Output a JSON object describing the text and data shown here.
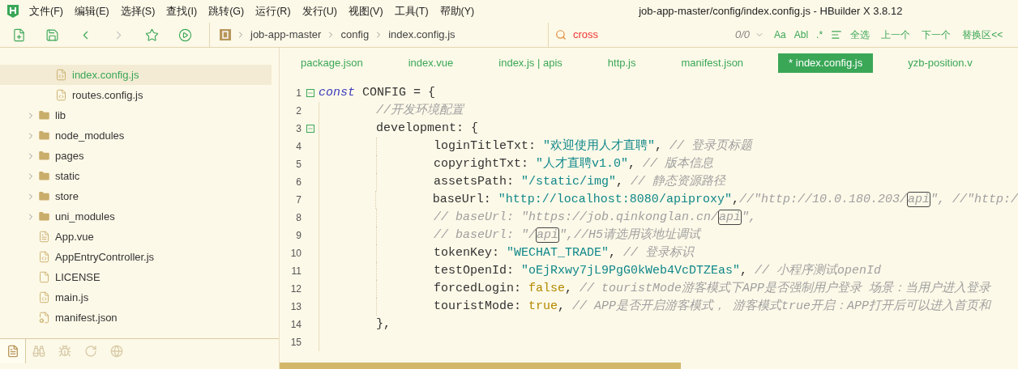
{
  "window": {
    "title": "job-app-master/config/index.config.js - HBuilder X 3.8.12"
  },
  "menu_bar": {
    "items": [
      "文件(F)",
      "编辑(E)",
      "选择(S)",
      "查找(I)",
      "跳转(G)",
      "运行(R)",
      "发行(U)",
      "视图(V)",
      "工具(T)",
      "帮助(Y)"
    ]
  },
  "toolbar": {
    "buttons": [
      {
        "kind": "new-file",
        "disabled": false
      },
      {
        "kind": "save",
        "disabled": false
      },
      {
        "kind": "back",
        "disabled": false
      },
      {
        "kind": "forward",
        "disabled": true
      },
      {
        "kind": "favorite",
        "disabled": false
      },
      {
        "kind": "run",
        "disabled": false
      }
    ]
  },
  "breadcrumb": [
    "job-app-master",
    "config",
    "index.config.js"
  ],
  "find_bar": {
    "value": "cross",
    "count": "0/0",
    "options": [
      "Aa",
      "Abl",
      ".*"
    ],
    "actions": [
      "全选",
      "上一个",
      "下一个",
      "替换区<<"
    ]
  },
  "sidebar": {
    "tree": [
      {
        "children": [
          {
            "label": "index.config.js",
            "kind": "js",
            "selected": true
          },
          {
            "label": "routes.config.js",
            "kind": "js",
            "selected": false
          }
        ]
      },
      {
        "label": "lib",
        "kind": "folder",
        "selected": false,
        "expanded": false
      },
      {
        "label": "node_modules",
        "kind": "folder",
        "selected": false,
        "expanded": false
      },
      {
        "label": "pages",
        "kind": "folder",
        "selected": false,
        "expanded": false
      },
      {
        "label": "static",
        "kind": "folder",
        "selected": false,
        "expanded": false
      },
      {
        "label": "store",
        "kind": "folder",
        "selected": false,
        "expanded": false
      },
      {
        "label": "uni_modules",
        "kind": "folder",
        "selected": false,
        "expanded": false
      },
      {
        "label": "App.vue",
        "kind": "vue",
        "selected": false
      },
      {
        "label": "AppEntryController.js",
        "kind": "js",
        "selected": false
      },
      {
        "label": "LICENSE",
        "kind": "text",
        "selected": false
      },
      {
        "label": "main.js",
        "kind": "js",
        "selected": false
      },
      {
        "label": "manifest.json",
        "kind": "config",
        "selected": false
      }
    ],
    "bottom_tabs": [
      {
        "kind": "files",
        "selected": true
      },
      {
        "kind": "search",
        "selected": false
      },
      {
        "kind": "debug",
        "selected": false
      },
      {
        "kind": "sync",
        "selected": false
      },
      {
        "kind": "cloud",
        "selected": false
      }
    ]
  },
  "editor": {
    "tabs": [
      {
        "label": "package.json",
        "selected": false
      },
      {
        "label": "index.vue",
        "selected": false
      },
      {
        "label": "index.js | apis",
        "selected": false
      },
      {
        "label": "http.js",
        "selected": false
      },
      {
        "label": "manifest.json",
        "selected": false
      },
      {
        "label": "* index.config.js",
        "selected": true
      },
      {
        "label": "yzb-position.v",
        "selected": false
      }
    ],
    "lines": [
      {
        "number": "1",
        "tokens": [
          {
            "kind": "keyword",
            "text": "const"
          },
          {
            "kind": "plain",
            "text": " CONFIG = {"
          }
        ],
        "children": [
          {
            "number": "2",
            "tokens": [
              {
                "kind": "comment",
                "text": "//开发环境配置"
              }
            ]
          },
          {
            "number": "3",
            "tokens": [
              {
                "kind": "plain",
                "text": "development: {"
              }
            ],
            "children": [
              {
                "number": "4",
                "tokens": [
                  {
                    "kind": "plain",
                    "text": "loginTitleTxt: "
                  },
                  {
                    "kind": "string",
                    "text": "\"欢迎使用人才直聘\""
                  },
                  {
                    "kind": "plain",
                    "text": ", "
                  },
                  {
                    "kind": "comment",
                    "text": "// 登录页标题"
                  }
                ]
              },
              {
                "number": "5",
                "tokens": [
                  {
                    "kind": "plain",
                    "text": "copyrightTxt: "
                  },
                  {
                    "kind": "string",
                    "text": "\"人才直聘v1.0\""
                  },
                  {
                    "kind": "plain",
                    "text": ", "
                  },
                  {
                    "kind": "comment",
                    "text": "// 版本信息"
                  }
                ]
              },
              {
                "number": "6",
                "tokens": [
                  {
                    "kind": "plain",
                    "text": "assetsPath: "
                  },
                  {
                    "kind": "string",
                    "text": "\"/static/img\""
                  },
                  {
                    "kind": "plain",
                    "text": ", "
                  },
                  {
                    "kind": "comment",
                    "text": "// 静态资源路径"
                  }
                ]
              },
              {
                "number": "7",
                "tokens": [
                  {
                    "kind": "plain",
                    "text": "baseUrl: "
                  },
                  {
                    "kind": "string",
                    "text": "\"http://localhost:8080/apiproxy\""
                  },
                  {
                    "kind": "plain",
                    "text": ","
                  },
                  {
                    "kind": "comment",
                    "text": "//\"http://10.0.180.203/"
                  },
                  {
                    "kind": "match",
                    "text": "api"
                  },
                  {
                    "kind": "comment",
                    "text": "\", //\"http:/"
                  }
                ]
              },
              {
                "number": "8",
                "tokens": [
                  {
                    "kind": "comment",
                    "text": "// baseUrl: \"https://job.qinkonglan.cn/"
                  },
                  {
                    "kind": "match",
                    "text": "api"
                  },
                  {
                    "kind": "comment",
                    "text": "\","
                  }
                ]
              },
              {
                "number": "9",
                "tokens": [
                  {
                    "kind": "comment",
                    "text": "// baseUrl: \"/"
                  },
                  {
                    "kind": "match",
                    "text": "api"
                  },
                  {
                    "kind": "comment",
                    "text": "\",//H5请选用该地址调试"
                  }
                ]
              },
              {
                "number": "10",
                "tokens": [
                  {
                    "kind": "plain",
                    "text": "tokenKey: "
                  },
                  {
                    "kind": "string",
                    "text": "\"WECHAT_TRADE\""
                  },
                  {
                    "kind": "plain",
                    "text": ", "
                  },
                  {
                    "kind": "comment",
                    "text": "// 登录标识"
                  }
                ]
              },
              {
                "number": "11",
                "tokens": [
                  {
                    "kind": "plain",
                    "text": "testOpenId: "
                  },
                  {
                    "kind": "string",
                    "text": "\"oEjRxwy7jL9PgG0kWeb4VcDTZEas\""
                  },
                  {
                    "kind": "plain",
                    "text": ", "
                  },
                  {
                    "kind": "comment",
                    "text": "// 小程序测试openId"
                  }
                ]
              },
              {
                "number": "12",
                "tokens": [
                  {
                    "kind": "plain",
                    "text": "forcedLogin: "
                  },
                  {
                    "kind": "bool",
                    "text": "false"
                  },
                  {
                    "kind": "plain",
                    "text": ", "
                  },
                  {
                    "kind": "comment",
                    "text": "// touristMode游客模式下APP是否强制用户登录 场景：当用户进入登录"
                  }
                ]
              },
              {
                "number": "13",
                "tokens": [
                  {
                    "kind": "plain",
                    "text": "touristMode: "
                  },
                  {
                    "kind": "bool",
                    "text": "true"
                  },
                  {
                    "kind": "plain",
                    "text": ", "
                  },
                  {
                    "kind": "comment",
                    "text": "// APP是否开启游客模式， 游客模式true开启：APP打开后可以进入首页和"
                  }
                ]
              }
            ]
          },
          {
            "number": "14",
            "tokens": [
              {
                "kind": "plain",
                "text": "},"
              }
            ]
          },
          {
            "number": "15"
          }
        ]
      }
    ]
  }
}
